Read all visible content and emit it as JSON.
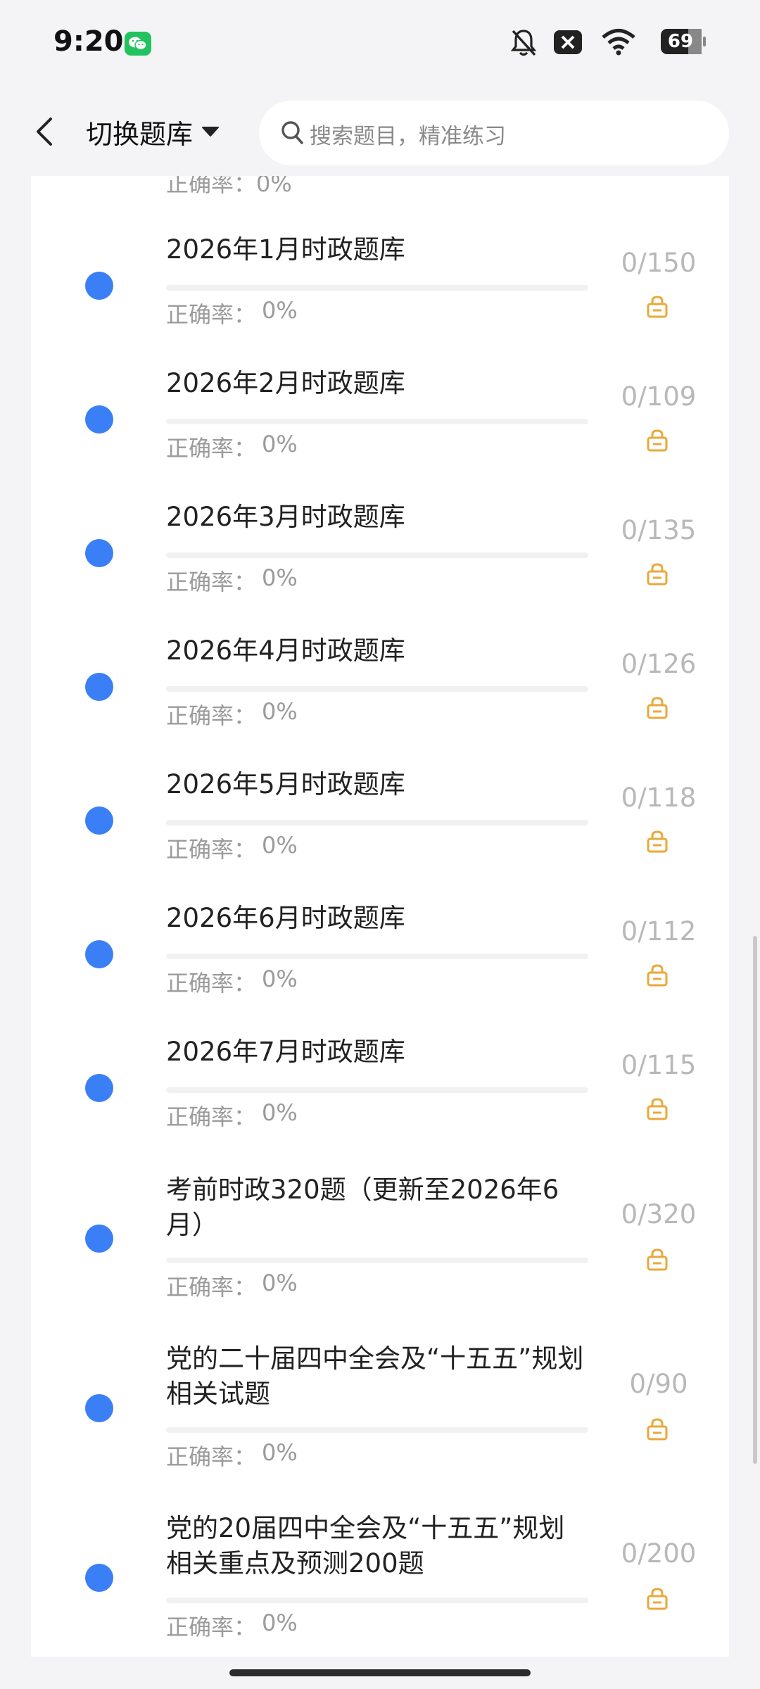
{
  "status_bar": {
    "time": "9:20",
    "battery_level": "69",
    "icons": [
      "wechat-icon",
      "bell-muted-icon",
      "close-box-icon",
      "wifi-icon",
      "battery-icon"
    ]
  },
  "header": {
    "back_icon": "chevron-left-icon",
    "switch_label": "切换题库",
    "caret_icon": "caret-down-icon",
    "search_placeholder": "搜索题目，精准练习",
    "search_icon": "search-icon"
  },
  "partial_row": {
    "accuracy_text": "正确率：0%"
  },
  "list": {
    "accuracy_label": "正确率：",
    "items": [
      {
        "title": "2026年1月时政题库",
        "accuracy": "0%",
        "count": "0/150",
        "progress": 0
      },
      {
        "title": "2026年2月时政题库",
        "accuracy": "0%",
        "count": "0/109",
        "progress": 0
      },
      {
        "title": "2026年3月时政题库",
        "accuracy": "0%",
        "count": "0/135",
        "progress": 0
      },
      {
        "title": "2026年4月时政题库",
        "accuracy": "0%",
        "count": "0/126",
        "progress": 0
      },
      {
        "title": "2026年5月时政题库",
        "accuracy": "0%",
        "count": "0/118",
        "progress": 0
      },
      {
        "title": "2026年6月时政题库",
        "accuracy": "0%",
        "count": "0/112",
        "progress": 0
      },
      {
        "title": "2026年7月时政题库",
        "accuracy": "0%",
        "count": "0/115",
        "progress": 0
      },
      {
        "title": "考前时政320题（更新至2026年6月）",
        "accuracy": "0%",
        "count": "0/320",
        "progress": 0
      },
      {
        "title": "党的二十届四中全会及“十五五”规划相关试题",
        "accuracy": "0%",
        "count": "0/90",
        "progress": 0
      },
      {
        "title": "党的20届四中全会及“十五五”规划相关重点及预测200题",
        "accuracy": "0%",
        "count": "0/200",
        "progress": 0
      }
    ]
  },
  "colors": {
    "dot": "#3b7ff6",
    "lock": "#e8a93a",
    "count": "#b8b8b8"
  }
}
